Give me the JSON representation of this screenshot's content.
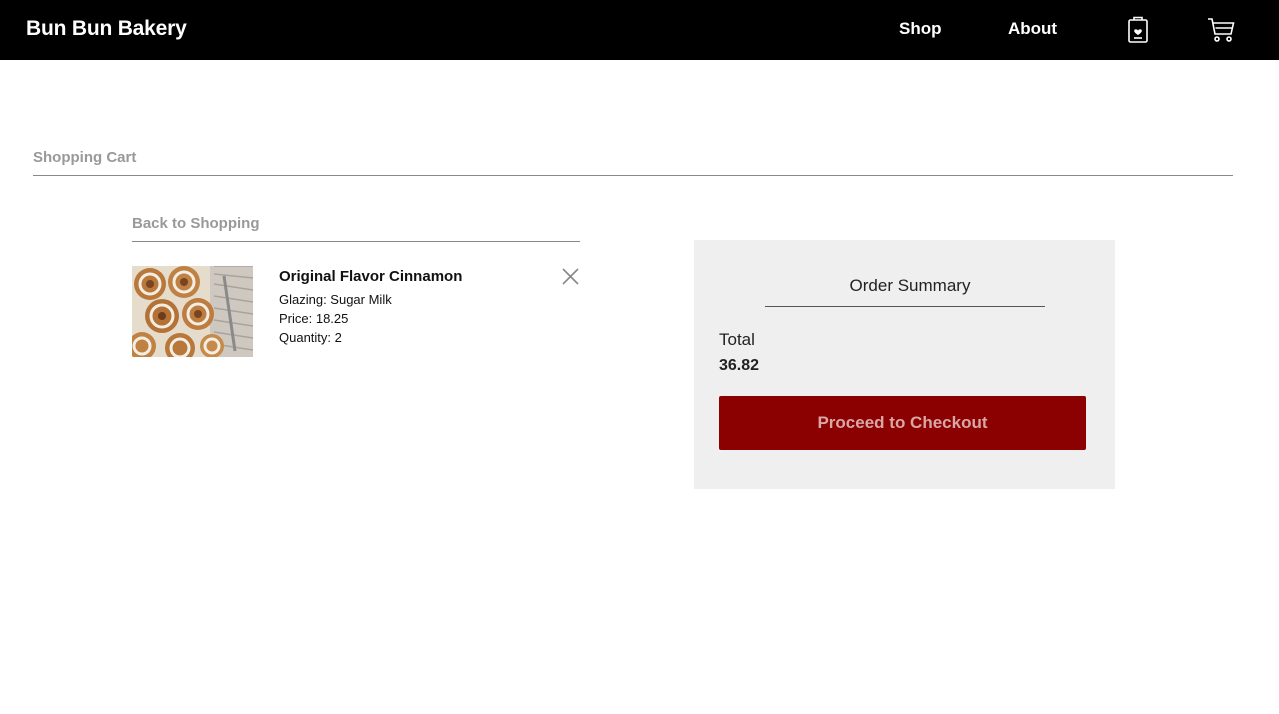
{
  "navbar": {
    "brand": "Bun Bun Bakery",
    "links": [
      "Shop",
      "About"
    ],
    "icons": [
      "wishlist-icon",
      "cart-icon"
    ]
  },
  "page": {
    "title": "Shopping Cart",
    "back_link": "Back to Shopping"
  },
  "cart": {
    "items": [
      {
        "name": "Original Flavor Cinnamon",
        "glazing": "Glazing: Sugar Milk",
        "price": "Price: 18.25",
        "quantity": "Quantity: 2",
        "image": "cinnamon-rolls-photo"
      }
    ]
  },
  "summary": {
    "title": "Order Summary",
    "total_label": "Total",
    "total_value": "36.82",
    "checkout_label": "Proceed to Checkout"
  },
  "colors": {
    "navbar_bg": "#000000",
    "accent": "#8b0000",
    "panel_bg": "#efefef",
    "muted_text": "#999999"
  }
}
